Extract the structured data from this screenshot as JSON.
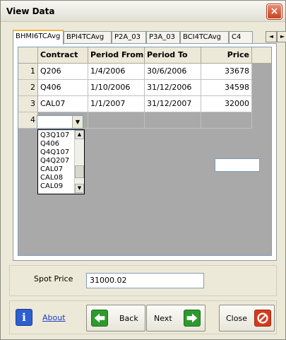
{
  "window": {
    "title": "View Data",
    "close_glyph": "×"
  },
  "tabs": [
    {
      "label": "BHMI6TCAvg",
      "active": true
    },
    {
      "label": "BPI4TCAvg",
      "active": false
    },
    {
      "label": "P2A_03",
      "active": false
    },
    {
      "label": "P3A_03",
      "active": false
    },
    {
      "label": "BCI4TCAvg",
      "active": false
    },
    {
      "label": "C4",
      "active": false
    }
  ],
  "tab_scroll": {
    "left_glyph": "◄",
    "right_glyph": "►"
  },
  "grid": {
    "columns": [
      "Contract",
      "Period From",
      "Period To",
      "Price"
    ],
    "rows": [
      {
        "row_num": "1",
        "contract": "Q206",
        "period_from": "1/4/2006",
        "period_to": "30/6/2006",
        "price": "33678"
      },
      {
        "row_num": "2",
        "contract": "Q406",
        "period_from": "1/10/2006",
        "period_to": "31/12/2006",
        "price": "34598"
      },
      {
        "row_num": "3",
        "contract": "CAL07",
        "period_from": "1/1/2007",
        "period_to": "31/12/2007",
        "price": "32000"
      }
    ],
    "new_row_num": "4",
    "combo_arrow_glyph": "▼"
  },
  "dropdown": {
    "items": [
      "Q3Q107",
      "Q406",
      "Q4Q107",
      "Q4Q207",
      "CAL07",
      "CAL08",
      "CAL09"
    ],
    "scroll_up_glyph": "▲",
    "scroll_down_glyph": "▼"
  },
  "spot": {
    "label": "Spot Price",
    "value": "31000.02"
  },
  "buttons": {
    "about": "About",
    "back": "Back",
    "next": "Next",
    "close": "Close"
  },
  "icons": {
    "info_glyph": "i"
  }
}
